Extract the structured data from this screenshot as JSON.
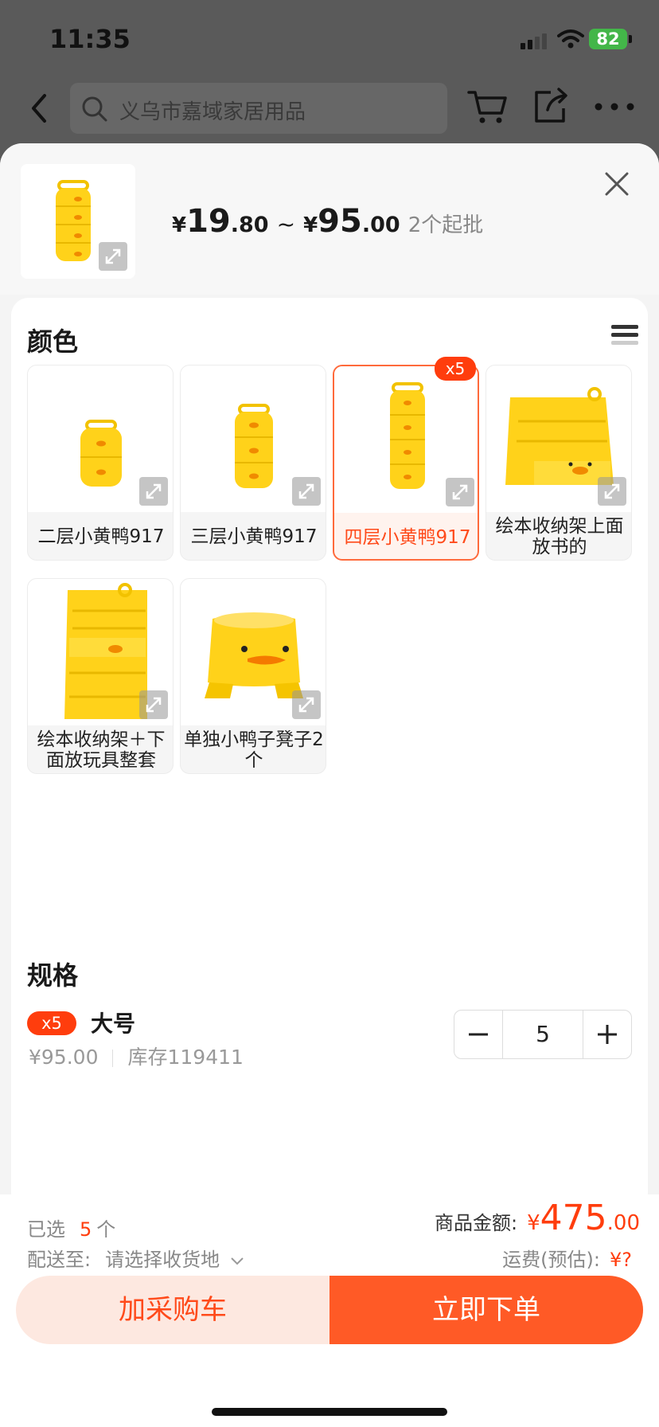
{
  "status": {
    "time": "11:35",
    "battery": "82"
  },
  "nav": {
    "search_placeholder": "义乌市嘉域家居用品"
  },
  "sku_header": {
    "price_low_cur": "¥",
    "price_low_int": "19",
    "price_low_dec": ".80",
    "tilde": "~",
    "price_high_cur": "¥",
    "price_high_int": "95",
    "price_high_dec": ".00",
    "min_order": "2个起批"
  },
  "color_section": {
    "title": "颜色",
    "options": [
      {
        "label": "二层小黄鸭917"
      },
      {
        "label": "三层小黄鸭917"
      },
      {
        "label": "四层小黄鸭917",
        "badge": "x5",
        "selected": true
      },
      {
        "label": "绘本收纳架上面放书的"
      },
      {
        "label": "绘本收纳架＋下面放玩具整套"
      },
      {
        "label": "单独小鸭子凳子2个"
      }
    ]
  },
  "spec_section": {
    "title": "规格",
    "item": {
      "badge": "x5",
      "name": "大号",
      "price": "¥95.00",
      "stock": "库存119411",
      "quantity": "5"
    }
  },
  "footer": {
    "selected_prefix": "已选",
    "selected_count": "5",
    "selected_unit": "个",
    "ship_label": "配送至:",
    "ship_value": "请选择收货地",
    "amount_label": "商品金额:",
    "amount_cur": "¥",
    "amount_int": "475",
    "amount_dec": ".00",
    "freight_label": "运费(预估):",
    "freight_value": "¥?",
    "add_cart": "加采购车",
    "buy_now": "立即下单"
  },
  "colors": {
    "accent": "#ff5a26",
    "accent_light": "#fde8e0",
    "badge": "#ff3d0d"
  },
  "icons": [
    "back-icon",
    "search-icon",
    "cart-icon",
    "share-icon",
    "more-icon",
    "close-icon",
    "expand-icon",
    "list-view-icon",
    "minus-icon",
    "plus-icon",
    "chevron-down-icon"
  ]
}
